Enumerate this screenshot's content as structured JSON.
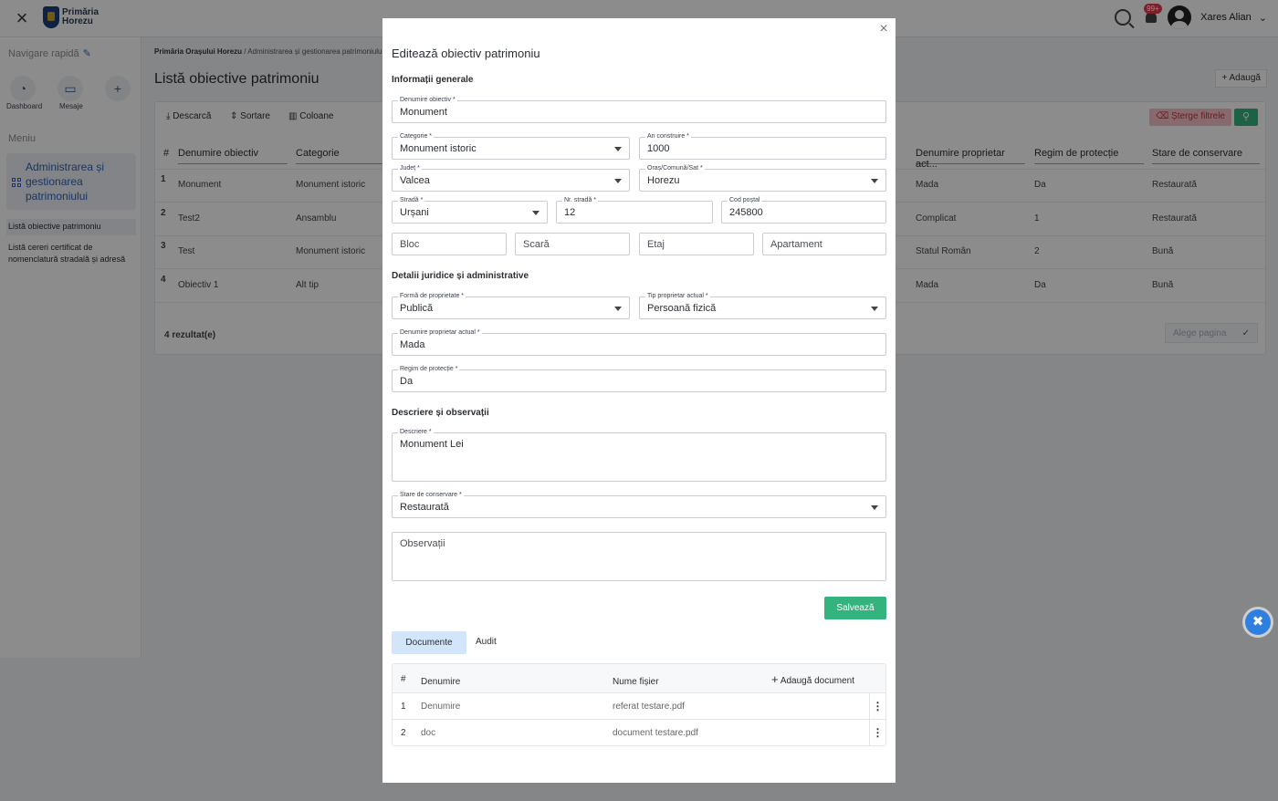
{
  "topbar": {
    "logo_line1": "Primăria",
    "logo_line2": "Horezu",
    "notif_badge": "99+",
    "user_name": "Xares Alian"
  },
  "sidebar": {
    "quick_nav": "Navigare rapidă",
    "quick_buttons": [
      {
        "label": "Dashboard",
        "icon": "pie-chart-icon"
      },
      {
        "label": "Mesaje",
        "icon": "inbox-icon"
      },
      {
        "label": "",
        "icon": "plus-icon"
      }
    ],
    "menu_title": "Meniu",
    "group_label": "Administrarea și gestionarea patrimoniului",
    "sub_items": [
      "Listă obiective patrimoniu",
      "Listă cereri certificat de nomenclatură stradală și adresă"
    ]
  },
  "main": {
    "breadcrumb_root": "Primăria Orașului Horezu",
    "breadcrumb_sep": "/",
    "breadcrumb_current": "Administrarea și gestionarea patrimoniului",
    "title": "Listă obiective patrimoniu",
    "add_label": "Adaugă",
    "toolbar": {
      "download": "Descarcă",
      "sort": "Sortare",
      "columns": "Coloane",
      "clear_filters": "Șterge filtrele"
    },
    "headers": {
      "num": "#",
      "name": "Denumire obiectiv",
      "category": "Categorie",
      "owner": "Denumire proprietar act...",
      "protection": "Regim de protecție",
      "conservation": "Stare de conservare"
    },
    "rows": [
      {
        "num": "1",
        "name": "Monument",
        "category": "Monument istoric",
        "owner": "Mada",
        "protection": "Da",
        "conservation": "Restaurată"
      },
      {
        "num": "2",
        "name": "Test2",
        "category": "Ansamblu",
        "owner": "Complicat",
        "protection": "1",
        "conservation": "Restaurată"
      },
      {
        "num": "3",
        "name": "Test",
        "category": "Monument istoric",
        "owner": "Statul Român",
        "protection": "2",
        "conservation": "Bună"
      },
      {
        "num": "4",
        "name": "Obiectiv 1",
        "category": "Alt tip",
        "owner": "Mada",
        "protection": "Da",
        "conservation": "Bună"
      }
    ],
    "results": "4 rezultat(e)",
    "page_select_placeholder": "Alege pagina"
  },
  "modal": {
    "title": "Editează obiectiv patrimoniu",
    "sections": {
      "general": "Informații generale",
      "legal": "Detalii juridice și administrative",
      "description": "Descriere și observații"
    },
    "fields": {
      "name": {
        "label": "Denumire obiectiv *",
        "value": "Monument"
      },
      "category": {
        "label": "Categorie *",
        "value": "Monument istoric"
      },
      "year": {
        "label": "An construire *",
        "value": "1000"
      },
      "county": {
        "label": "Județ *",
        "value": "Valcea"
      },
      "city": {
        "label": "Oraș/Comună/Sat *",
        "value": "Horezu"
      },
      "street": {
        "label": "Stradă *",
        "value": "Urșani"
      },
      "street_no": {
        "label": "Nr. stradă *",
        "value": "12"
      },
      "postal": {
        "label": "Cod poștal",
        "value": "245800"
      },
      "bloc": {
        "placeholder": "Bloc"
      },
      "scara": {
        "placeholder": "Scară"
      },
      "etaj": {
        "placeholder": "Etaj"
      },
      "apartament": {
        "placeholder": "Apartament"
      },
      "ownership": {
        "label": "Formă de proprietate *",
        "value": "Publică"
      },
      "owner_type": {
        "label": "Tip proprietar actual *",
        "value": "Persoană fizică"
      },
      "owner_name": {
        "label": "Denumire proprietar actual *",
        "value": "Mada"
      },
      "protection": {
        "label": "Regim de protecție *",
        "value": "Da"
      },
      "description": {
        "label": "Descriere *",
        "value": "Monument Lei"
      },
      "conservation": {
        "label": "Stare de conservare *",
        "value": "Restaurată"
      },
      "observations": {
        "placeholder": "Observații"
      }
    },
    "save_label": "Salvează",
    "tabs": {
      "documents": "Documente",
      "audit": "Audit"
    },
    "doc_table": {
      "headers": {
        "num": "#",
        "name": "Denumire",
        "file": "Nume fișier",
        "add": "Adaugă document"
      },
      "rows": [
        {
          "num": "1",
          "name": "Denumire",
          "file": "referat testare.pdf"
        },
        {
          "num": "2",
          "name": "doc",
          "file": "document testare.pdf"
        }
      ]
    }
  },
  "colors": {
    "accent": "#2d5fb5",
    "save": "#35b37e",
    "danger": "#c6303e",
    "tab_active": "#d3e5fb"
  }
}
